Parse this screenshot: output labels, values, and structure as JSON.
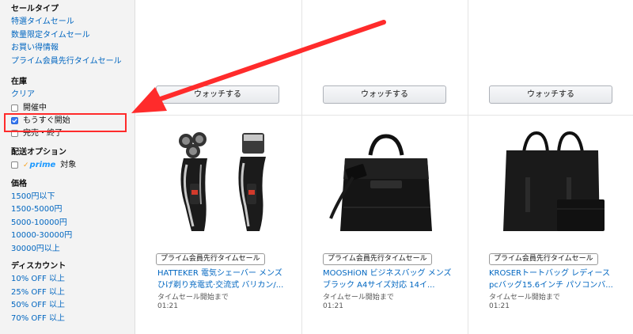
{
  "sidebar": {
    "sale_type": {
      "title": "セールタイプ",
      "links": [
        "特選タイムセール",
        "数量限定タイムセール",
        "お買い得情報",
        "プライム会員先行タイムセール"
      ]
    },
    "stock": {
      "title": "在庫",
      "clear": "クリア",
      "options": [
        {
          "label": "開催中",
          "checked": false
        },
        {
          "label": "もうすぐ開始",
          "checked": true
        },
        {
          "label": "完売・終了",
          "checked": false
        }
      ]
    },
    "shipping": {
      "title": "配送オプション",
      "prime_logo": "prime",
      "prime_label": "対象"
    },
    "price": {
      "title": "価格",
      "links": [
        "1500円以下",
        "1500-5000円",
        "5000-10000円",
        "10000-30000円",
        "30000円以上"
      ]
    },
    "discount": {
      "title": "ディスカウント",
      "links": [
        "10% OFF 以上",
        "25% OFF 以上",
        "50% OFF 以上",
        "70% OFF 以上"
      ]
    }
  },
  "grid": {
    "watch_label": "ウォッチする",
    "products": [
      {
        "badge": "プライム会員先行タイムセール",
        "title_line1": "HATTEKER 電気シェーバー メンズ",
        "title_line2": "ひげ剃り充電式·交流式 バリカン/...",
        "status_label": "タイムセール開始まで",
        "countdown": "01:21",
        "image": "electric-shaver"
      },
      {
        "badge": "プライム会員先行タイムセール",
        "title_line1": "MOOSHiON ビジネスバッグ メンズ",
        "title_line2": "ブラック A4サイズ対応 14イ...",
        "status_label": "タイムセール開始まで",
        "countdown": "01:21",
        "image": "business-bag"
      },
      {
        "badge": "プライム会員先行タイムセール",
        "title_line1": "KROSERトートバッグ レディース",
        "title_line2": "pcバッグ15.6インチ パソコンバ...",
        "status_label": "タイムセール開始まで",
        "countdown": "01:21",
        "image": "tote-bag"
      }
    ]
  },
  "colors": {
    "link": "#0066c0",
    "highlight": "#ff2b2b",
    "sidebar_bg": "#f3f3f3",
    "checkbox_checked": "#3478f6",
    "prime_blue": "#1a98ff"
  }
}
